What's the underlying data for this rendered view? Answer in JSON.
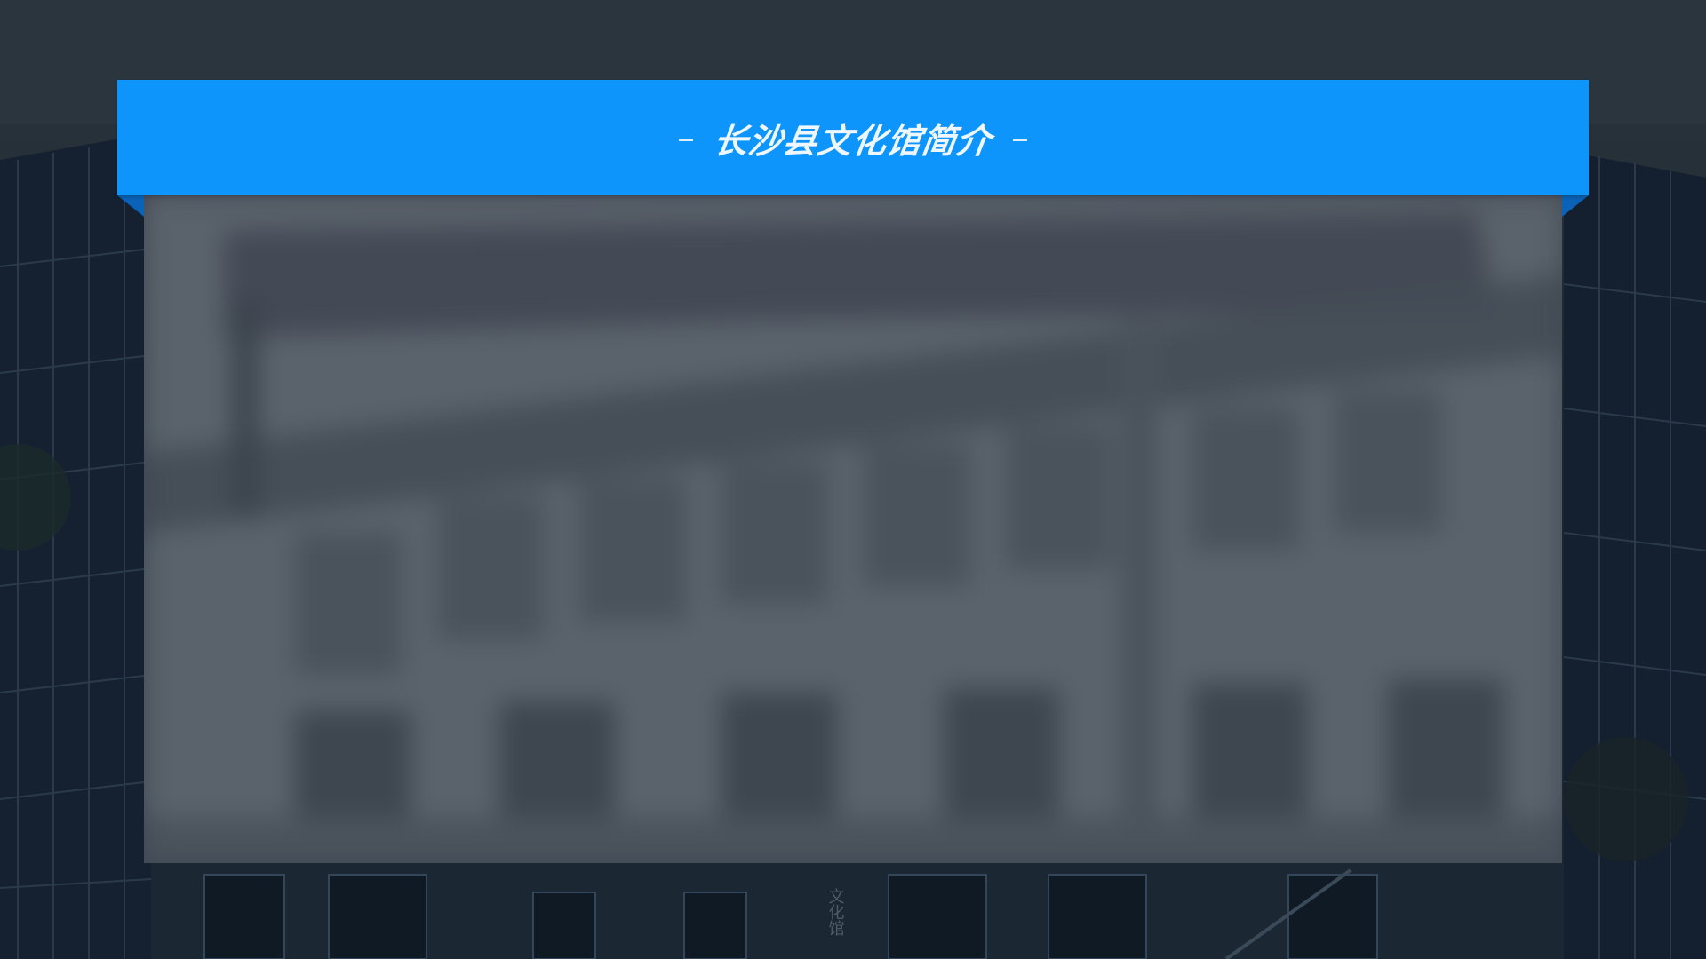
{
  "slide": {
    "title": "长沙县文化馆简介",
    "banner_color": "#0d95fb",
    "banner_fold_color": "#0a63b8",
    "panel_color": "#58606a"
  },
  "background": {
    "building_sign": "文化馆"
  },
  "panel": {
    "body_text": ""
  }
}
